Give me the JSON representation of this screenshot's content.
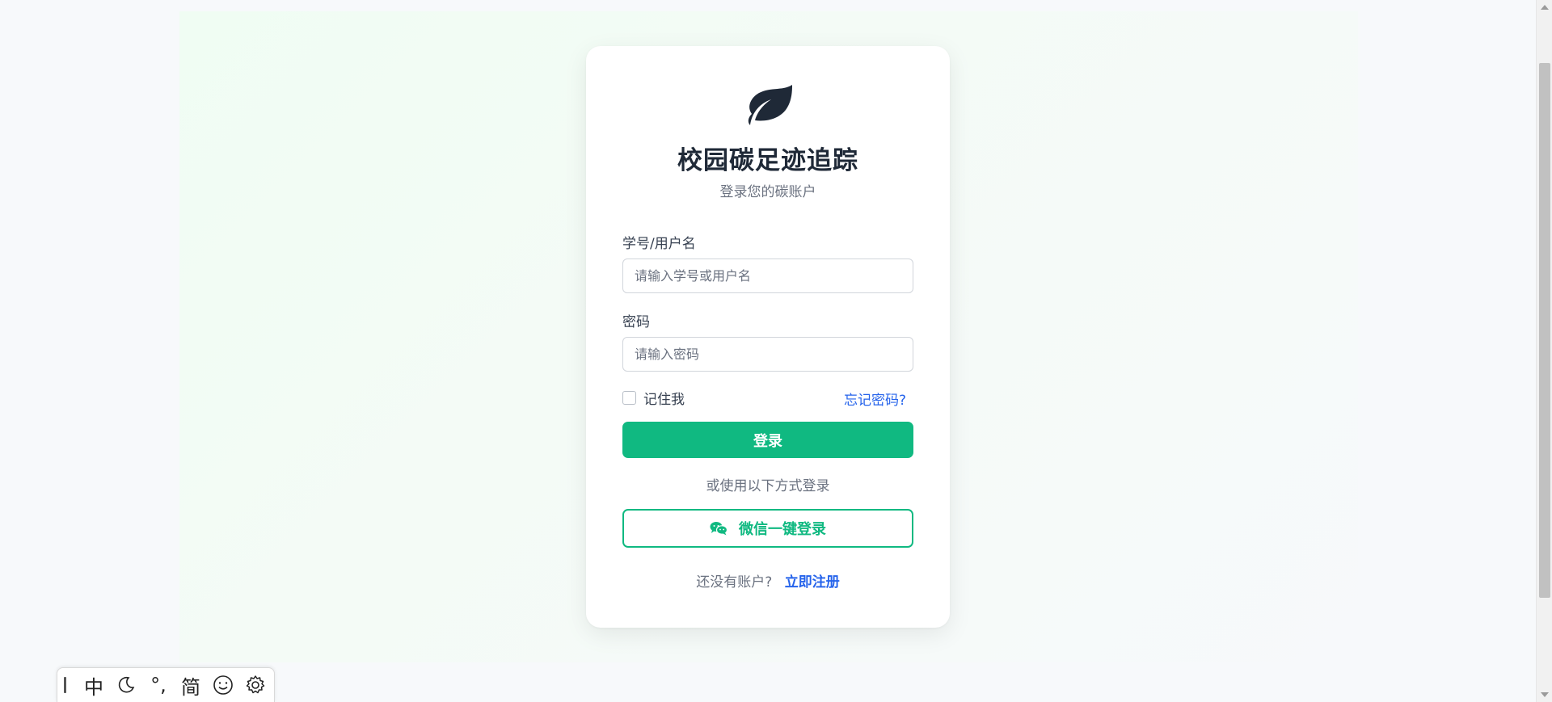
{
  "app": {
    "title": "校园碳足迹追踪",
    "subtitle": "登录您的碳账户"
  },
  "form": {
    "username_label": "学号/用户名",
    "username_placeholder": "请输入学号或用户名",
    "username_value": "",
    "password_label": "密码",
    "password_placeholder": "请输入密码",
    "password_value": "",
    "remember_label": "记住我",
    "remember_checked": false,
    "forgot_label": "忘记密码?",
    "login_label": "登录"
  },
  "alt_login": {
    "divider_text": "或使用以下方式登录",
    "wechat_label": "微信一键登录",
    "wechat_icon": "wechat-icon"
  },
  "register": {
    "question": "还没有账户?",
    "link_label": "立即注册"
  },
  "logo_icon": "leaf-icon",
  "colors": {
    "primary": "#10b981",
    "link": "#2563eb",
    "title": "#1f2937"
  },
  "ime_toolbar": {
    "mode": "中",
    "theme_icon": "moon-icon",
    "punct": "°,",
    "script": "简",
    "emoji_icon": "smiley-icon",
    "settings_icon": "gear-icon"
  }
}
